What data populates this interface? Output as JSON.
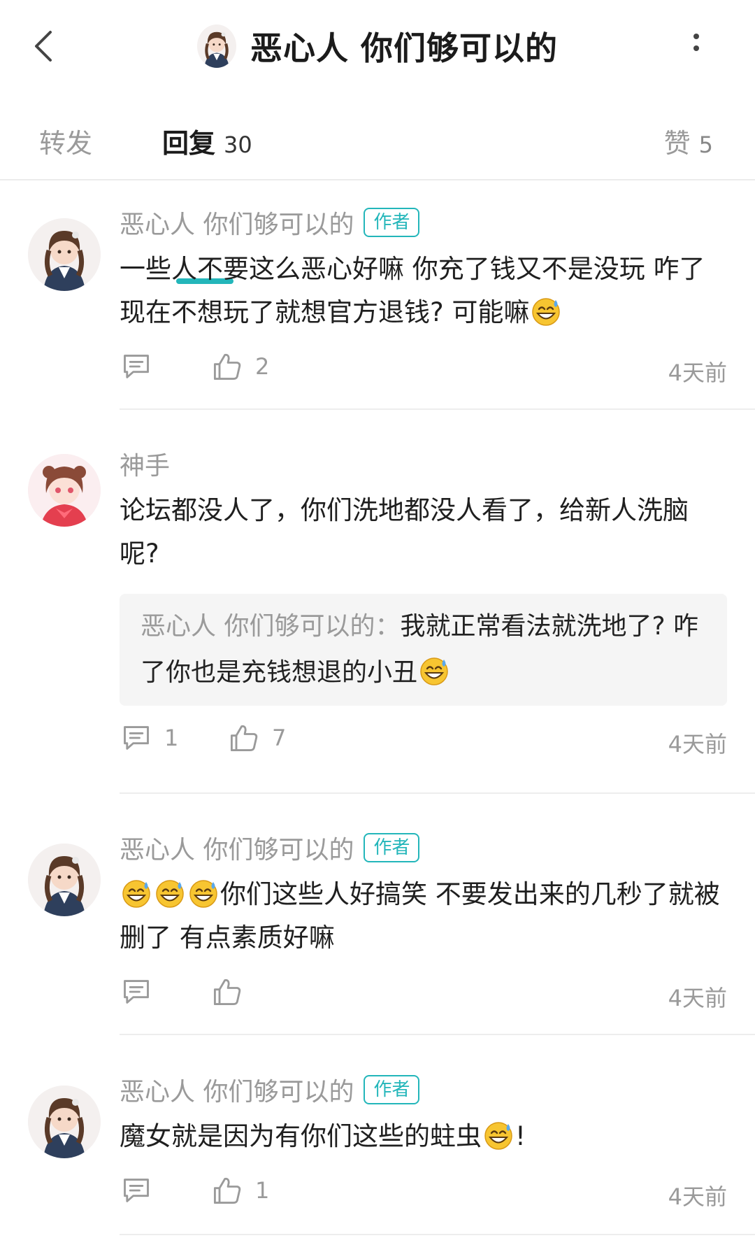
{
  "header": {
    "title": "恶心人 你们够可以的",
    "back_icon": "chevron-left-icon",
    "more_icon": "vertical-ellipsis-icon"
  },
  "tabs": {
    "forward": {
      "label": "转发",
      "count": ""
    },
    "reply": {
      "label": "回复",
      "count": "30"
    },
    "like": {
      "label": "赞",
      "count": "5"
    }
  },
  "colors": {
    "accent": "#23b6ba",
    "muted": "#9a9a9a",
    "text": "#1f1f1f"
  },
  "comments": [
    {
      "username": "恶心人 你们够可以的",
      "badge": "作者",
      "text_parts": [
        "一些人不要这么恶心好嘛 你充了钱又不是没玩 咋了 现在不想玩了就想官方退钱? 可能嘛",
        "sweat-smile-emoji"
      ],
      "reply_count": "",
      "like_count": "2",
      "time": "4天前"
    },
    {
      "username": "神手",
      "badge": "",
      "text": "论坛都没人了，你们洗地都没人看了，给新人洗脑呢?",
      "quote": {
        "author": "恶心人 你们够可以的",
        "separator": "：",
        "text": "我就正常看法就洗地了? 咋了你也是充钱想退的小丑"
      },
      "reply_count": "1",
      "like_count": "7",
      "time": "4天前"
    },
    {
      "username": "恶心人 你们够可以的",
      "badge": "作者",
      "text": "你们这些人好搞笑 不要发出来的几秒了就被删了 有点素质好嘛",
      "reply_count": "",
      "like_count": "",
      "time": "4天前"
    },
    {
      "username": "恶心人 你们够可以的",
      "badge": "作者",
      "text": "魔女就是因为有你们这些的蛀虫",
      "text_suffix": "!",
      "reply_count": "",
      "like_count": "1",
      "time": "4天前"
    }
  ]
}
